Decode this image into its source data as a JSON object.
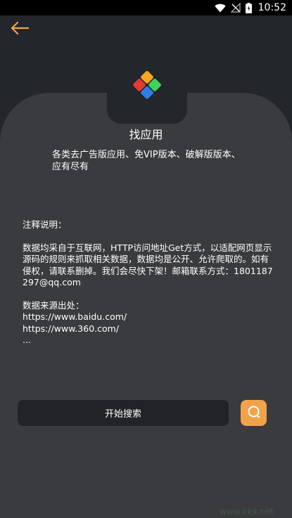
{
  "status_bar": {
    "time": "10:52",
    "icons": [
      "wifi-icon",
      "no-signal-icon",
      "battery-icon"
    ]
  },
  "header": {
    "back_icon": "arrow-left-icon"
  },
  "app": {
    "title": "找应用",
    "description_lines": [
      "各类去广告版应用、免VIP版本、破解版版本、",
      "应有尽有"
    ],
    "logo_colors": [
      "#f5a623",
      "#e53935",
      "#43d15a",
      "#2f7ee6"
    ]
  },
  "notes": {
    "heading": "注释说明：",
    "paragraph": "数据均采自于互联网，HTTP访问地址Get方式，以适配网页显示源码的规则来抓取相关数据，数据均是公开、允许爬取的。如有侵权，请联系删掉。我们会尽快下架！邮箱联系方式：1801187297@qq.com",
    "sources_heading": "数据来源出处：",
    "sources": [
      "https://www.baidu.com/",
      "https://www.360.com/",
      "..."
    ]
  },
  "actions": {
    "search_label": "开始搜索",
    "search_icon": "search-icon"
  },
  "watermark": "www.kkx.net",
  "colors": {
    "accent": "#f3a24c",
    "background": "#23262b",
    "card": "#3a3b3f"
  }
}
